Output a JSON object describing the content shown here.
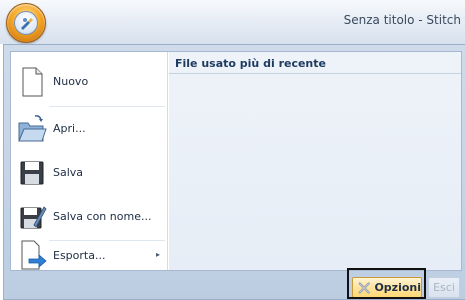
{
  "window": {
    "title": "Senza titolo - Stitch"
  },
  "menu": {
    "items": [
      {
        "label": "Nuovo",
        "icon": "new-document-icon"
      },
      {
        "label": "Apri...",
        "icon": "open-folder-icon"
      },
      {
        "label": "Salva",
        "icon": "save-disk-icon"
      },
      {
        "label": "Salva con nome...",
        "icon": "save-as-icon"
      },
      {
        "label": "Esporta...",
        "icon": "export-icon",
        "has_submenu": true
      }
    ],
    "submenu_arrow": "▸"
  },
  "recent": {
    "header": "File usato più di recente"
  },
  "footer": {
    "options_label": "Opzioni",
    "exit_label": "Esci"
  },
  "colors": {
    "orb": "#f5a623",
    "options_button": "#ffe4a0",
    "frame": "#111111"
  }
}
